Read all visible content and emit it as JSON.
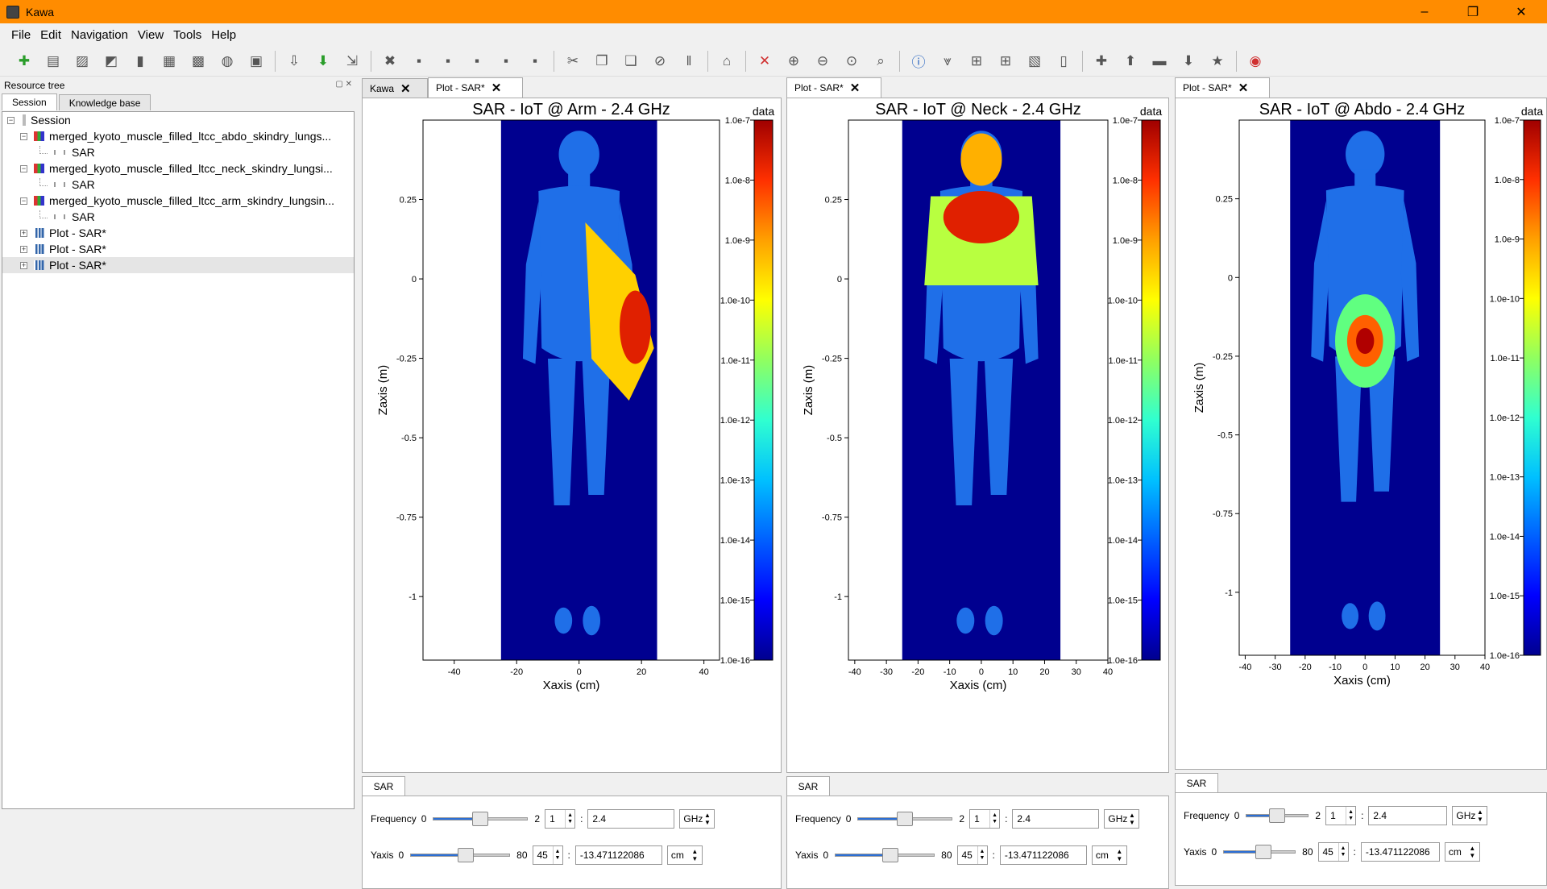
{
  "window": {
    "title": "Kawa",
    "minimize": "–",
    "maximize": "❐",
    "close": "✕"
  },
  "menu": [
    "File",
    "Edit",
    "Navigation",
    "View",
    "Tools",
    "Help"
  ],
  "toolbar_icons": [
    "add-icon",
    "document-icon",
    "image-icon",
    "pdf-icon",
    "bar-chart-icon",
    "grid-icon",
    "palette-icon",
    "database-icon",
    "cube-icon",
    "import-icon",
    "download-icon",
    "export-icon",
    "delete-icon",
    "save-icon",
    "save-all-icon",
    "save-as-icon",
    "save-copy-icon",
    "save-session-icon",
    "cut-icon",
    "copy-icon",
    "paste-icon",
    "forbid-icon",
    "pause-icon",
    "home-icon",
    "select-icon",
    "zoom-in-icon",
    "zoom-out-icon",
    "zoom-region-icon",
    "zoom-icon",
    "info-icon",
    "filter-icon",
    "crosshair-icon",
    "grid-toggle-icon",
    "colormap-icon",
    "clipboard-icon",
    "plus-icon",
    "up-icon",
    "minus-icon",
    "down-icon",
    "star-icon",
    "help-icon"
  ],
  "left_dock": {
    "title": "Resource tree",
    "tabs": [
      "Session",
      "Knowledge base"
    ],
    "tree": [
      {
        "label": "Session",
        "level": 0,
        "icon": "session-icon"
      },
      {
        "label": "merged_kyoto_muscle_filled_ltcc_abdo_skindry_lungs...",
        "level": 1,
        "icon": "mesh-icon"
      },
      {
        "label": "SAR",
        "level": 2,
        "icon": "sar-icon"
      },
      {
        "label": "merged_kyoto_muscle_filled_ltcc_neck_skindry_lungsi...",
        "level": 1,
        "icon": "mesh-icon"
      },
      {
        "label": "SAR",
        "level": 2,
        "icon": "sar-icon"
      },
      {
        "label": "merged_kyoto_muscle_filled_ltcc_arm_skindry_lungsin...",
        "level": 1,
        "icon": "mesh-icon"
      },
      {
        "label": "SAR",
        "level": 2,
        "icon": "sar-icon"
      },
      {
        "label": "Plot - SAR*",
        "level": 1,
        "icon": "plot-icon"
      },
      {
        "label": "Plot - SAR*",
        "level": 1,
        "icon": "plot-icon"
      },
      {
        "label": "Plot - SAR*",
        "level": 1,
        "icon": "plot-icon"
      }
    ]
  },
  "panels": [
    {
      "tabs": [
        "Kawa",
        "Plot - SAR*"
      ],
      "plot": {
        "title": "SAR - IoT @ Arm - 2.4 GHz",
        "xlabel": "Xaxis (cm)",
        "ylabel": "Zaxis (m)",
        "cb_label": "data",
        "xticks": [
          "-40",
          "-20",
          "0",
          "20",
          "40"
        ],
        "yticks": [
          "0.25",
          "0",
          "-0.25",
          "-0.5",
          "-0.75",
          "-1"
        ],
        "cbticks": [
          "1.0e-7",
          "1.0e-8",
          "1.0e-9",
          "1.0e-10",
          "1.0e-11",
          "1.0e-12",
          "1.0e-13",
          "1.0e-14",
          "1.0e-15",
          "1.0e-16"
        ]
      },
      "ctrl": {
        "tab": "SAR",
        "freq": {
          "label": "Frequency",
          "min": "0",
          "max": "2",
          "index": "1",
          "value": "2.4",
          "unit": "GHz",
          "level": 0.5
        },
        "yaxis": {
          "label": "Yaxis",
          "min": "0",
          "max": "80",
          "index": "45",
          "value": "-13.471122086",
          "unit": "cm",
          "level": 0.56
        }
      }
    },
    {
      "tabs": [
        "Plot - SAR*"
      ],
      "plot": {
        "title": "SAR - IoT @ Neck - 2.4 GHz",
        "xlabel": "Xaxis (cm)",
        "ylabel": "Zaxis (m)",
        "cb_label": "data",
        "xticks": [
          "-40",
          "-30",
          "-20",
          "-10",
          "0",
          "10",
          "20",
          "30",
          "40"
        ],
        "yticks": [
          "0.25",
          "0",
          "-0.25",
          "-0.5",
          "-0.75",
          "-1"
        ],
        "cbticks": [
          "1.0e-7",
          "1.0e-8",
          "1.0e-9",
          "1.0e-10",
          "1.0e-11",
          "1.0e-12",
          "1.0e-13",
          "1.0e-14",
          "1.0e-15",
          "1.0e-16"
        ]
      },
      "ctrl": {
        "tab": "SAR",
        "freq": {
          "label": "Frequency",
          "min": "0",
          "max": "2",
          "index": "1",
          "value": "2.4",
          "unit": "GHz",
          "level": 0.5
        },
        "yaxis": {
          "label": "Yaxis",
          "min": "0",
          "max": "80",
          "index": "45",
          "value": "-13.471122086",
          "unit": "cm",
          "level": 0.56
        }
      }
    },
    {
      "tabs": [
        "Plot - SAR*"
      ],
      "plot": {
        "title": "SAR - IoT @ Abdo - 2.4 GHz",
        "xlabel": "Xaxis (cm)",
        "ylabel": "Zaxis (m)",
        "cb_label": "data",
        "xticks": [
          "-40",
          "-30",
          "-20",
          "-10",
          "0",
          "10",
          "20",
          "30",
          "40"
        ],
        "yticks": [
          "0.25",
          "0",
          "-0.25",
          "-0.5",
          "-0.75",
          "-1"
        ],
        "cbticks": [
          "1.0e-7",
          "1.0e-8",
          "1.0e-9",
          "1.0e-10",
          "1.0e-11",
          "1.0e-12",
          "1.0e-13",
          "1.0e-14",
          "1.0e-15",
          "1.0e-16"
        ]
      },
      "ctrl": {
        "tab": "SAR",
        "freq": {
          "label": "Frequency",
          "min": "0",
          "max": "2",
          "index": "1",
          "value": "2.4",
          "unit": "GHz",
          "level": 0.5
        },
        "yaxis": {
          "label": "Yaxis",
          "min": "0",
          "max": "80",
          "index": "45",
          "value": "-13.471122086",
          "unit": "cm",
          "level": 0.56
        }
      }
    }
  ]
}
